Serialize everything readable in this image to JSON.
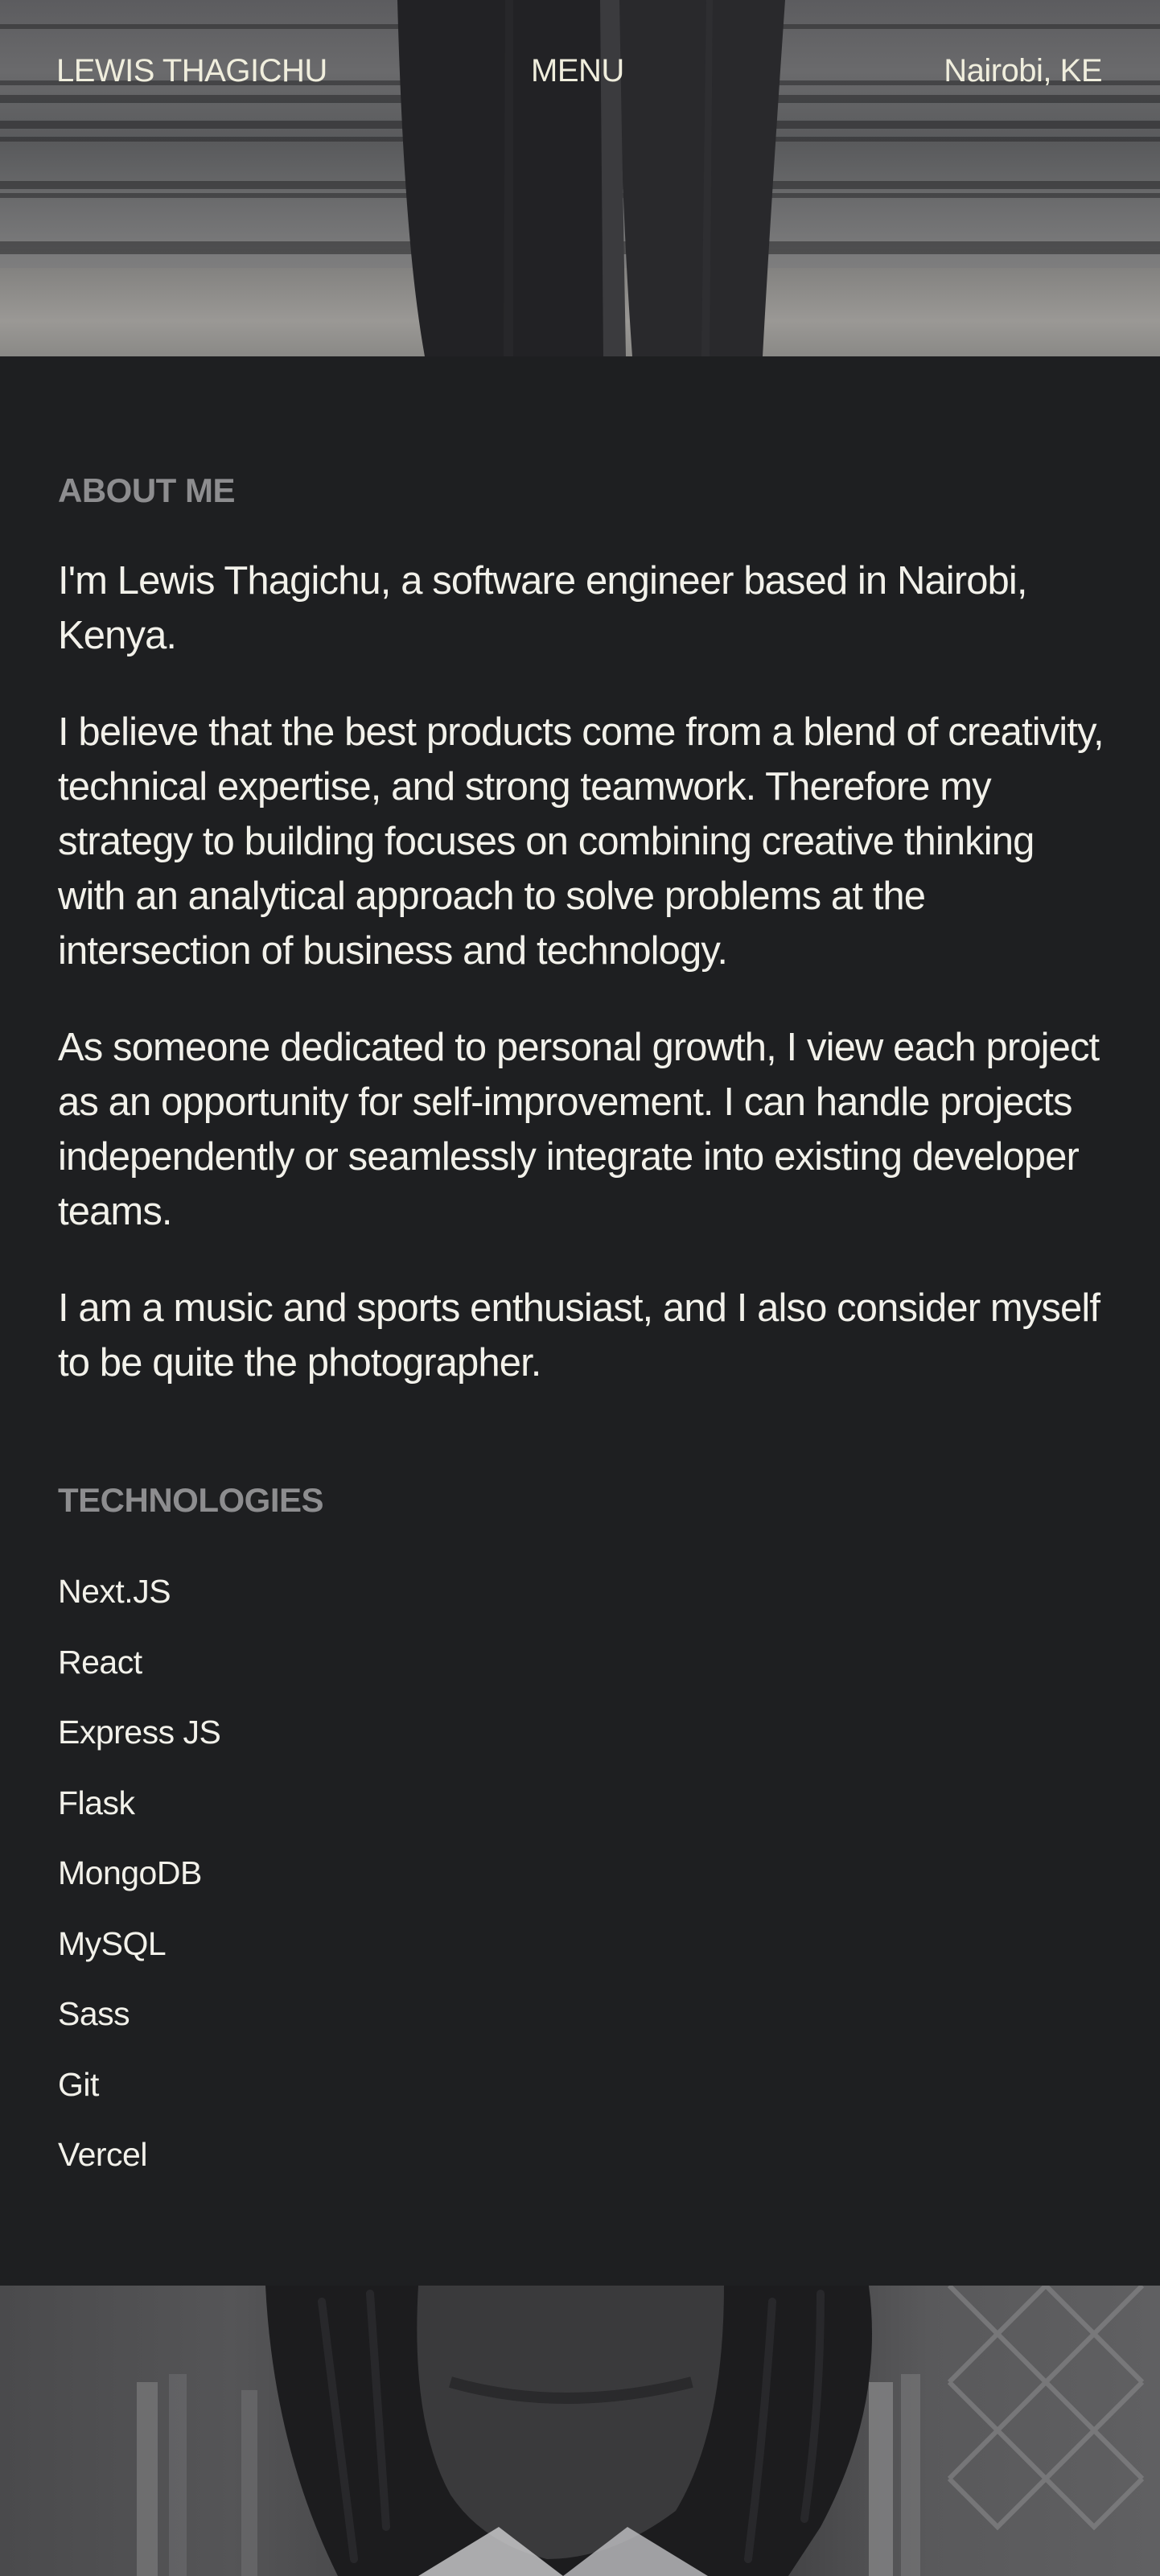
{
  "nav": {
    "brand": "LEWIS THAGICHU",
    "menu": "MENU",
    "location": "Nairobi, KE"
  },
  "about": {
    "heading": "ABOUT ME",
    "paragraphs": [
      "I'm Lewis Thagichu, a software engineer based in Nairobi, Kenya.",
      "I believe that the best products come from a blend of creativity, technical expertise, and strong teamwork. Therefore my strategy to building focuses on combining creative thinking with an analytical approach to solve problems at the intersection of business and technology.",
      "As someone dedicated to personal growth, I view each project as an opportunity for self-improvement. I can handle projects independently or seamlessly integrate into existing developer teams.",
      "I am a music and sports enthusiast, and I also consider myself to be quite the photographer."
    ]
  },
  "technologies": {
    "heading": "TECHNOLOGIES",
    "items": [
      "Next.JS",
      "React",
      "Express JS",
      "Flask",
      "MongoDB",
      "MySQL",
      "Sass",
      "Git",
      "Vercel"
    ]
  },
  "colors": {
    "background": "#1e1f21",
    "text": "#f2f1ea",
    "nav_text": "#f0eedd",
    "heading_muted": "#8d8d8f"
  }
}
